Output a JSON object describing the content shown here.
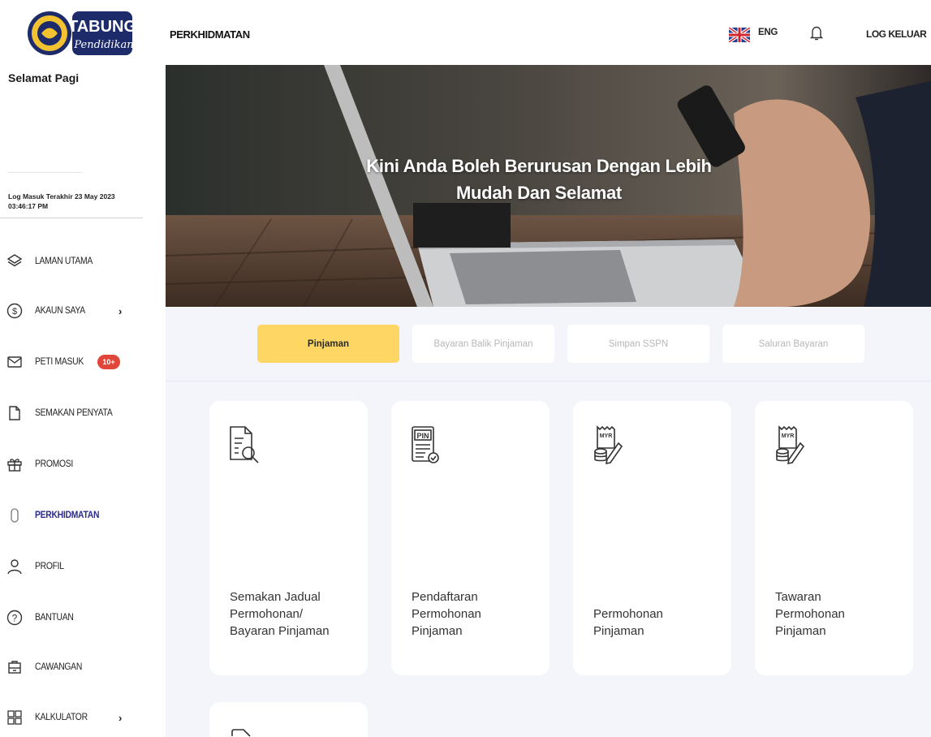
{
  "brand": {
    "logo_word": "TABUNG",
    "logo_script": "Pendidikan"
  },
  "sidebar": {
    "greeting": "Selamat Pagi",
    "last_login": "Log Masuk Terakhir 23 May 2023 03:46:17 PM",
    "items": [
      {
        "label": "LAMAN UTAMA",
        "icon": "layers-icon"
      },
      {
        "label": "AKAUN SAYA",
        "icon": "dollar-circle-icon",
        "has_chevron": true
      },
      {
        "label": "PETI MASUK",
        "icon": "envelope-icon",
        "badge": "10+"
      },
      {
        "label": "SEMAKAN PENYATA",
        "icon": "document-icon"
      },
      {
        "label": "PROMOSI",
        "icon": "gift-icon"
      },
      {
        "label": "PERKHIDMATAN",
        "icon": "capsule-icon",
        "active": true
      },
      {
        "label": "PROFIL",
        "icon": "user-icon"
      },
      {
        "label": "BANTUAN",
        "icon": "help-circle-icon"
      },
      {
        "label": "CAWANGAN",
        "icon": "branch-icon"
      },
      {
        "label": "KALKULATOR",
        "icon": "calculator-icon",
        "has_chevron": true
      }
    ],
    "chevron": "›"
  },
  "topbar": {
    "title": "PERKHIDMATAN",
    "language": "ENG",
    "logout": "LOG KELUAR"
  },
  "hero": {
    "line1": "Kini Anda Boleh Berurusan Dengan Lebih",
    "line2": "Mudah Dan Selamat"
  },
  "tabs": [
    {
      "label": "Pinjaman",
      "active": true
    },
    {
      "label": "Bayaran Balik Pinjaman",
      "active": false
    },
    {
      "label": "Simpan SSPN",
      "active": false
    },
    {
      "label": "Saluran Bayaran",
      "active": false
    }
  ],
  "cards": [
    {
      "lines": [
        "Semakan Jadual",
        "Permohonan/",
        "Bayaran Pinjaman"
      ],
      "icon": "document-search-icon"
    },
    {
      "lines": [
        "Pendaftaran",
        "Permohonan",
        "Pinjaman"
      ],
      "icon": "pin-document-icon",
      "icon_text": "PIN"
    },
    {
      "lines": [
        "Permohonan",
        "Pinjaman"
      ],
      "icon": "myr-receipt-icon",
      "icon_text": "MYR"
    },
    {
      "lines": [
        "Tawaran",
        "Permohonan",
        "Pinjaman"
      ],
      "icon": "myr-receipt-icon",
      "icon_text": "MYR"
    }
  ],
  "colors": {
    "accent_yellow": "#fdd663",
    "active_nav": "#2c2c8c",
    "badge_red": "#e0463a",
    "content_bg": "#f3f5fa"
  }
}
